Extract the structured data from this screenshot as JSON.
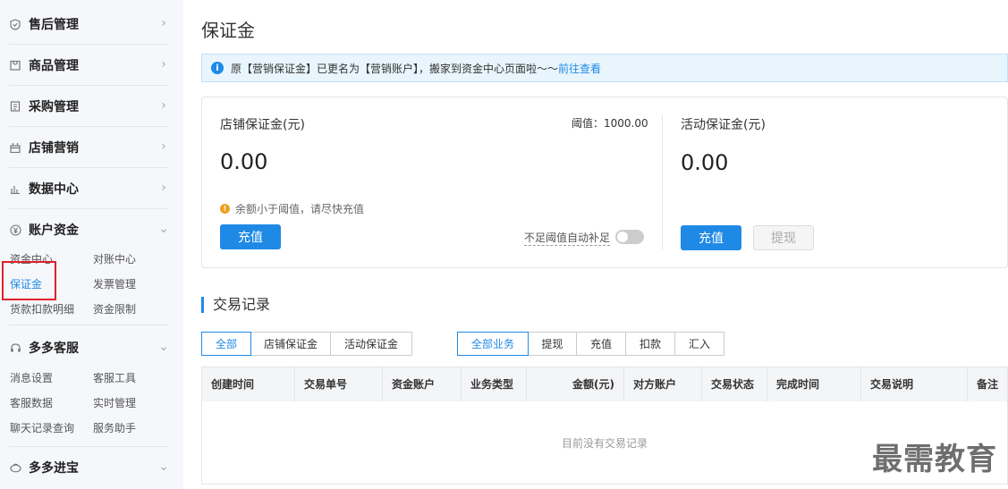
{
  "sidebar": {
    "groups": [
      {
        "label": "售后管理",
        "icon": "shield-icon"
      },
      {
        "label": "商品管理",
        "icon": "bag-icon"
      },
      {
        "label": "采购管理",
        "icon": "list-icon"
      },
      {
        "label": "店铺营销",
        "icon": "gift-icon"
      },
      {
        "label": "数据中心",
        "icon": "bar-chart-icon"
      },
      {
        "label": "账户资金",
        "icon": "yen-icon"
      },
      {
        "label": "多多客服",
        "icon": "headset-icon"
      },
      {
        "label": "多多进宝",
        "icon": "treasure-icon"
      }
    ],
    "account_items": [
      "资金中心",
      "对账中心",
      "保证金",
      "发票管理",
      "货款扣款明细",
      "资金限制"
    ],
    "service_items": [
      "消息设置",
      "客服工具",
      "客服数据",
      "实时管理",
      "聊天记录查询",
      "服务助手"
    ]
  },
  "main": {
    "title": "保证金",
    "notice": {
      "text": "原【营销保证金】已更名为【营销账户】，搬家到资金中心页面啦～～",
      "link": "前往查看"
    },
    "shop_deposit": {
      "title": "店铺保证金(元)",
      "threshold": "阈值：1000.00",
      "amount": "0.00",
      "warning": "余额小于阈值，请尽快充值",
      "recharge": "充值",
      "auto_topup": "不足阈值自动补足"
    },
    "activity_deposit": {
      "title": "活动保证金(元)",
      "amount": "0.00",
      "recharge": "充值",
      "withdraw": "提现"
    },
    "records": {
      "title": "交易记录",
      "account_tabs": [
        "全部",
        "店铺保证金",
        "活动保证金"
      ],
      "type_tabs": [
        "全部业务",
        "提现",
        "充值",
        "扣款",
        "汇入"
      ],
      "columns": [
        "创建时间",
        "交易单号",
        "资金账户",
        "业务类型",
        "金额(元)",
        "对方账户",
        "交易状态",
        "完成时间",
        "交易说明",
        "备注"
      ],
      "empty": "目前没有交易记录"
    }
  },
  "watermark": "最需教育",
  "colors": {
    "accent": "#1f8ae6",
    "highlight": "#e0202a",
    "warning": "#f0a020"
  }
}
